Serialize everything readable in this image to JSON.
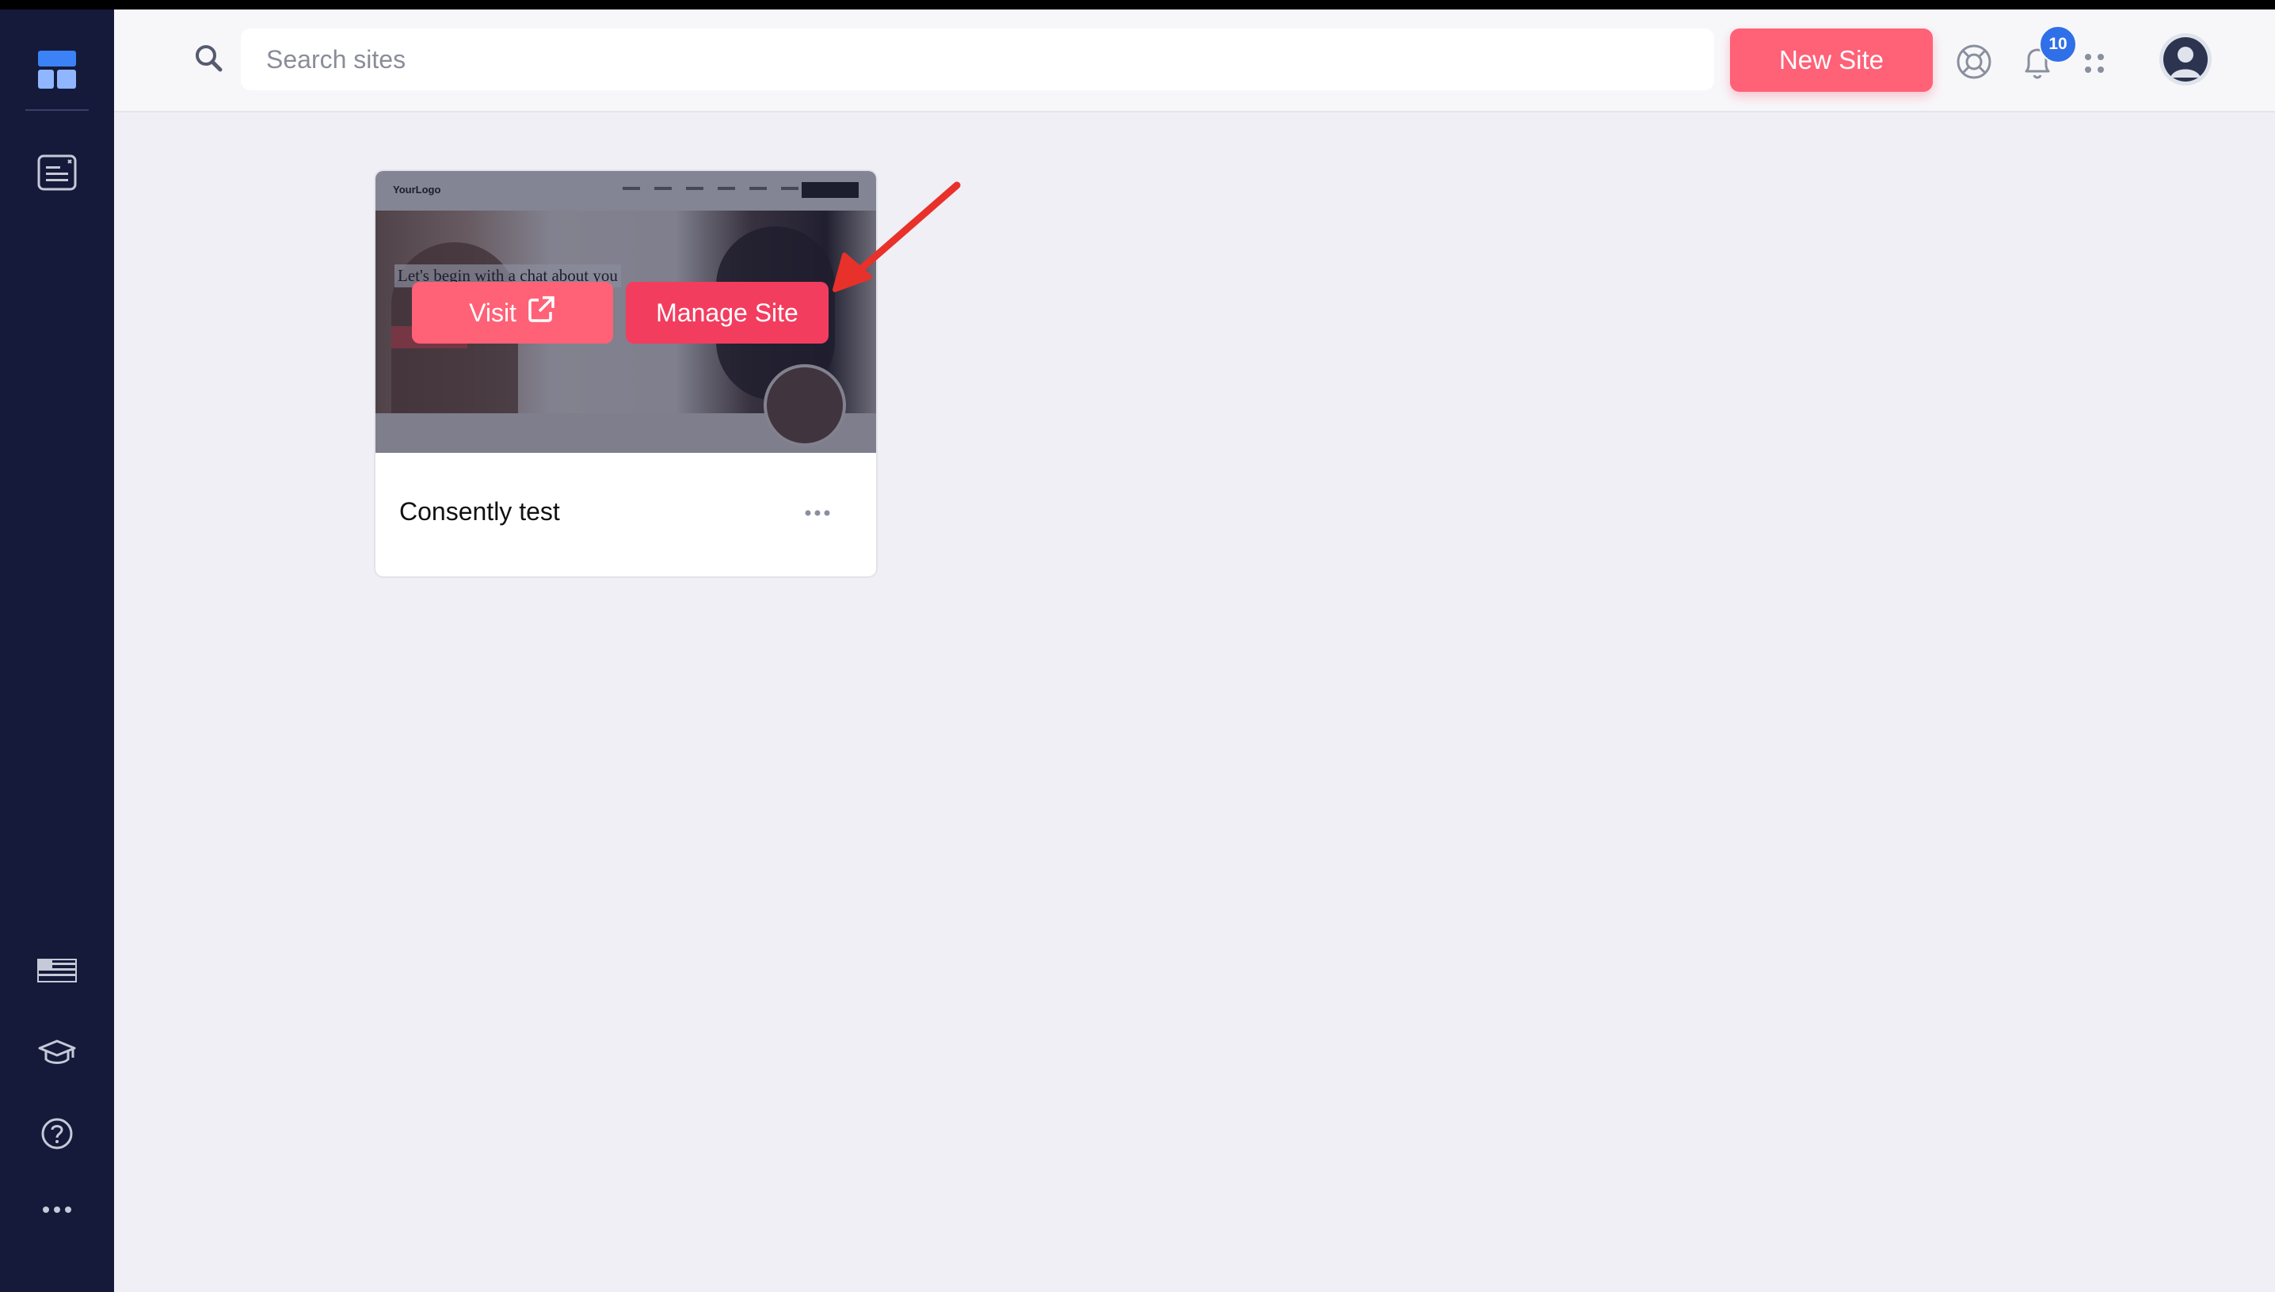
{
  "header": {
    "search_placeholder": "Search sites",
    "new_site_label": "New Site",
    "notification_count": "10"
  },
  "sidebar": {
    "top_items": [
      "dashboard-icon",
      "sites-icon"
    ],
    "bottom_items": [
      "language-flag-icon",
      "academy-icon",
      "help-icon",
      "more-icon"
    ]
  },
  "sites": [
    {
      "name": "Consently test",
      "visit_label": "Visit",
      "manage_label": "Manage Site",
      "thumbnail": {
        "logo": "YourLogo",
        "headline": "Let's begin with a chat about you"
      }
    }
  ],
  "colors": {
    "sidebar": "#151a3a",
    "primary": "#ff6177",
    "manage": "#f23d5f",
    "badge": "#2f6fe8",
    "background": "#efeff5",
    "annotation_arrow": "#e8312a"
  }
}
